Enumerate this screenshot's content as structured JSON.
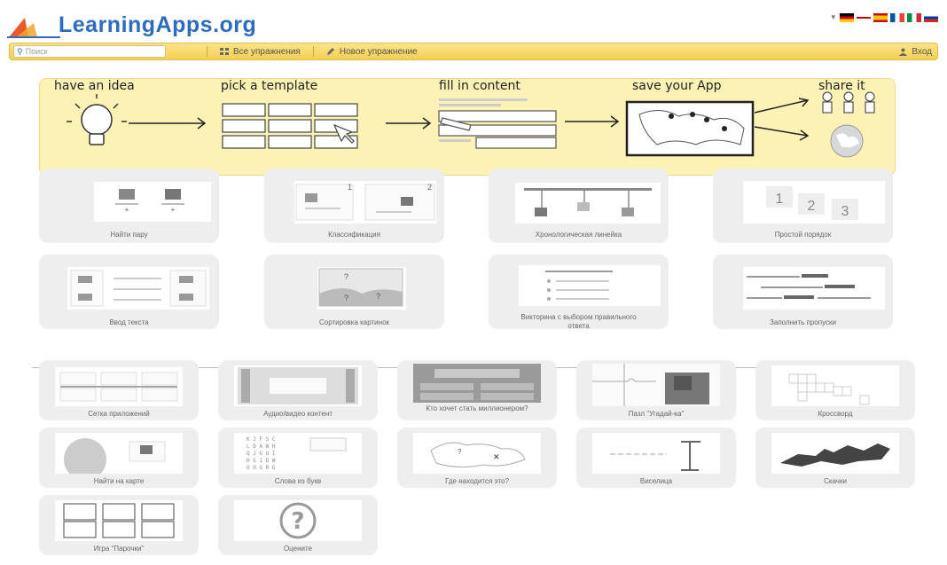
{
  "header": {
    "logo_text": "LearningApps.org",
    "flags": [
      "de",
      "gb",
      "es",
      "fr",
      "it",
      "ru"
    ]
  },
  "topbar": {
    "search_placeholder": "Поиск",
    "all_exercises": "Все упражнения",
    "new_exercise": "Новое упражнение",
    "login": "Вход"
  },
  "banner": {
    "steps": [
      "have an idea",
      "pick a template",
      "fill in content",
      "save your App",
      "share it"
    ]
  },
  "templates_main": [
    {
      "label": "Найти пару"
    },
    {
      "label": "Классификация"
    },
    {
      "label": "Хронологическая линейка"
    },
    {
      "label": "Простой порядок"
    },
    {
      "label": "Ввод текста"
    },
    {
      "label": "Сортировка картинок"
    },
    {
      "label": "Викторина с выбором правильного ответа"
    },
    {
      "label": "Заполнить пропуски"
    }
  ],
  "templates_more": [
    {
      "label": "Сетка приложений"
    },
    {
      "label": "Аудио/видео контент"
    },
    {
      "label": "Кто хочет стать миллионером?"
    },
    {
      "label": "Пазл \"Угадай-ка\""
    },
    {
      "label": "Кроссворд"
    },
    {
      "label": "Найти на карте"
    },
    {
      "label": "Слова из букв"
    },
    {
      "label": "Где находится это?"
    },
    {
      "label": "Виселица"
    },
    {
      "label": "Скачки"
    },
    {
      "label": "Игра \"Парочки\""
    },
    {
      "label": "Оцените"
    }
  ],
  "colors": {
    "brand_blue": "#2a6cc0",
    "topbar_yellow": "#f4cf52",
    "banner_bg": "#fdf2b6",
    "tile_bg": "#eeeeee"
  }
}
